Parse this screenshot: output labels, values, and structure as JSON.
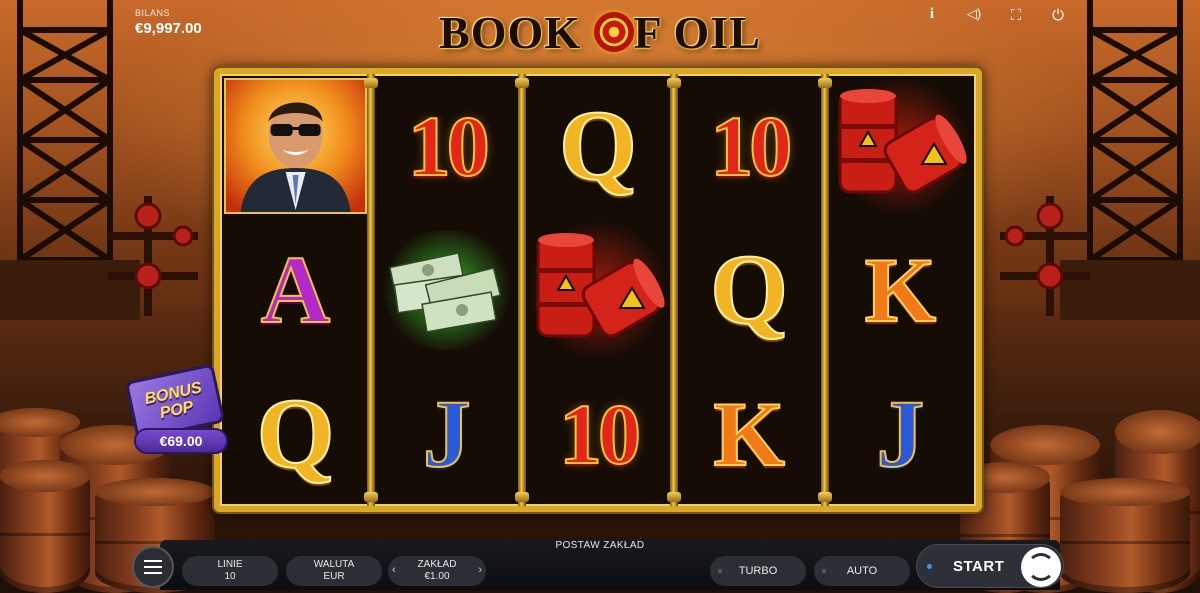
{
  "game": {
    "title_left": "BOOK ",
    "title_right": "F OIL",
    "balance_label": "BILANS",
    "balance_value": "€9,997.00"
  },
  "top_icons": [
    "info-icon",
    "sound-icon",
    "fullscreen-icon",
    "power-icon"
  ],
  "top_icon_glyphs": {
    "info": "i",
    "sound": "◁)",
    "fullscreen": "⛶",
    "power": "⏻"
  },
  "reels": [
    [
      "agent",
      "A",
      "Q"
    ],
    [
      "10",
      "cash",
      "J"
    ],
    [
      "Q",
      "barrels",
      "10"
    ],
    [
      "10",
      "Q",
      "K"
    ],
    [
      "barrels",
      "K",
      "J"
    ]
  ],
  "bonus": {
    "badge_line1": "BONUS",
    "badge_line2": "POP",
    "amount": "€69.00"
  },
  "controls": {
    "bet_title": "POSTAW ZAKŁAD",
    "lines_label": "LINIE",
    "lines_value": "10",
    "currency_label": "WALUTA",
    "currency_value": "EUR",
    "bet_label": "ZAKŁAD",
    "bet_value": "€1.00",
    "bet_prev": "‹",
    "bet_next": "›",
    "turbo_label": "TURBO",
    "auto_label": "AUTO",
    "start_label": "START"
  },
  "colors": {
    "frame_gold": "#d8a82a",
    "panel_dark": "#191a1f",
    "start_dot": "#2e9cf0"
  }
}
